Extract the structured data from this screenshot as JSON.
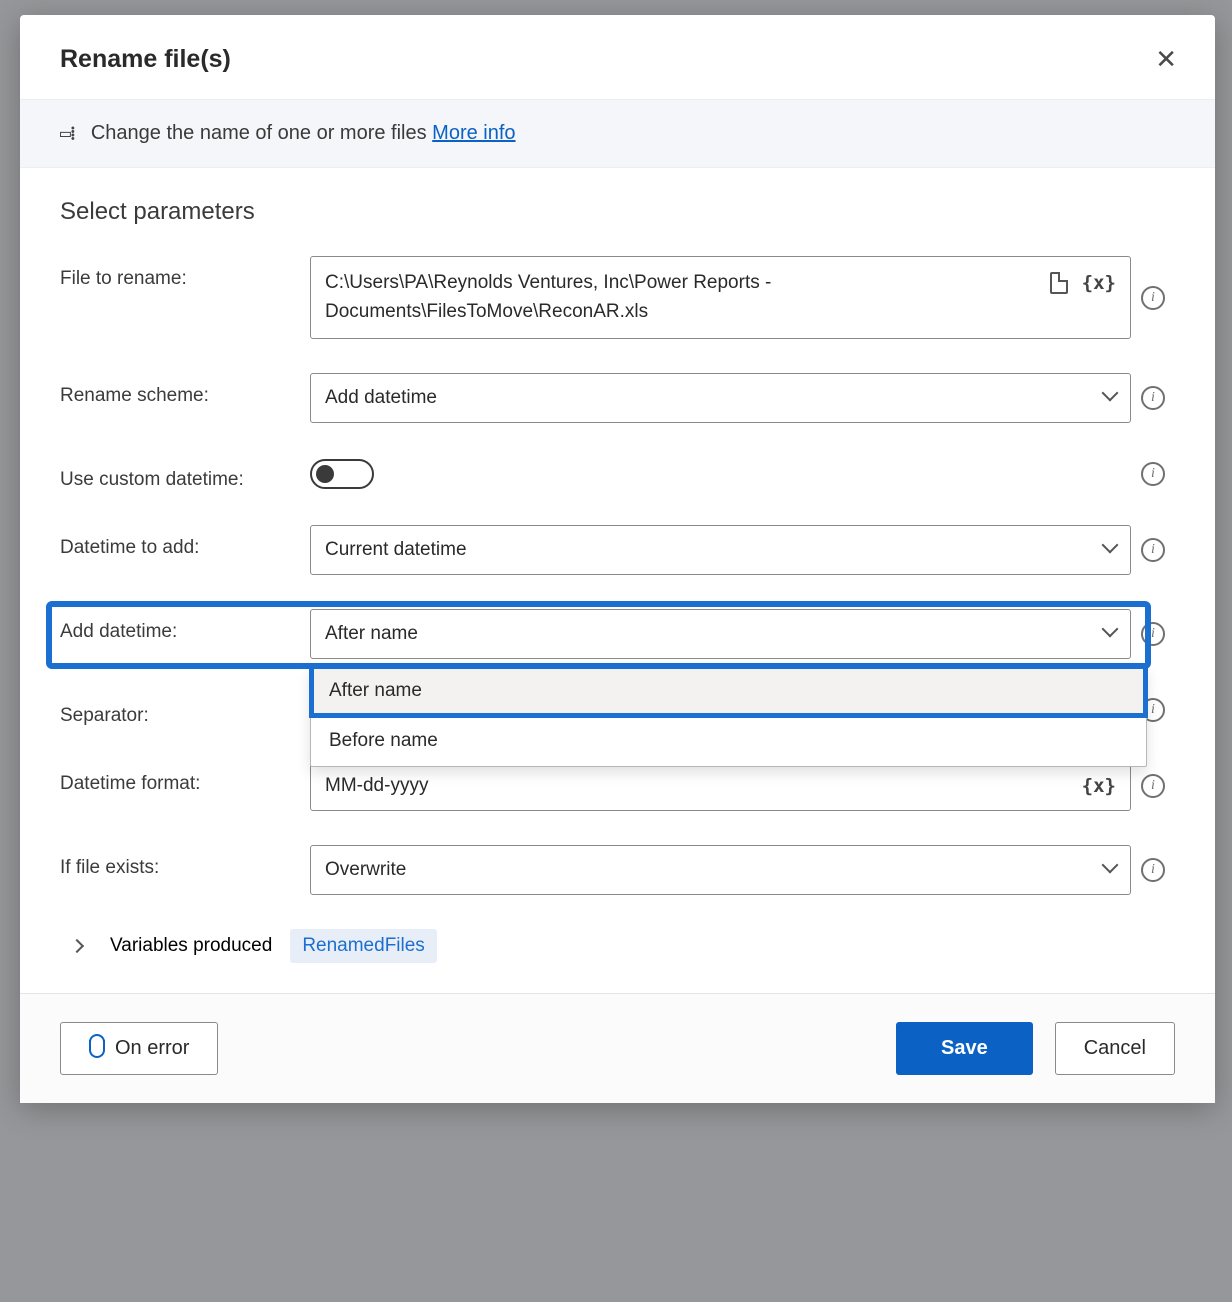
{
  "dialog": {
    "title": "Rename file(s)",
    "description": "Change the name of one or more files",
    "more_info": "More info"
  },
  "section_title": "Select parameters",
  "fields": {
    "file_to_rename": {
      "label": "File to rename:",
      "value": "C:\\Users\\PA\\Reynolds Ventures, Inc\\Power Reports - Documents\\FilesToMove\\ReconAR.xls"
    },
    "rename_scheme": {
      "label": "Rename scheme:",
      "value": "Add datetime"
    },
    "use_custom_datetime": {
      "label": "Use custom datetime:",
      "value": false
    },
    "datetime_to_add": {
      "label": "Datetime to add:",
      "value": "Current datetime"
    },
    "add_datetime": {
      "label": "Add datetime:",
      "value": "After name",
      "options": [
        "After name",
        "Before name"
      ]
    },
    "separator": {
      "label": "Separator:",
      "value": ""
    },
    "datetime_format": {
      "label": "Datetime format:",
      "value": "MM-dd-yyyy"
    },
    "if_file_exists": {
      "label": "If file exists:",
      "value": "Overwrite"
    }
  },
  "variables_produced": {
    "label": "Variables produced",
    "chip": "RenamedFiles"
  },
  "footer": {
    "on_error": "On error",
    "save": "Save",
    "cancel": "Cancel"
  }
}
